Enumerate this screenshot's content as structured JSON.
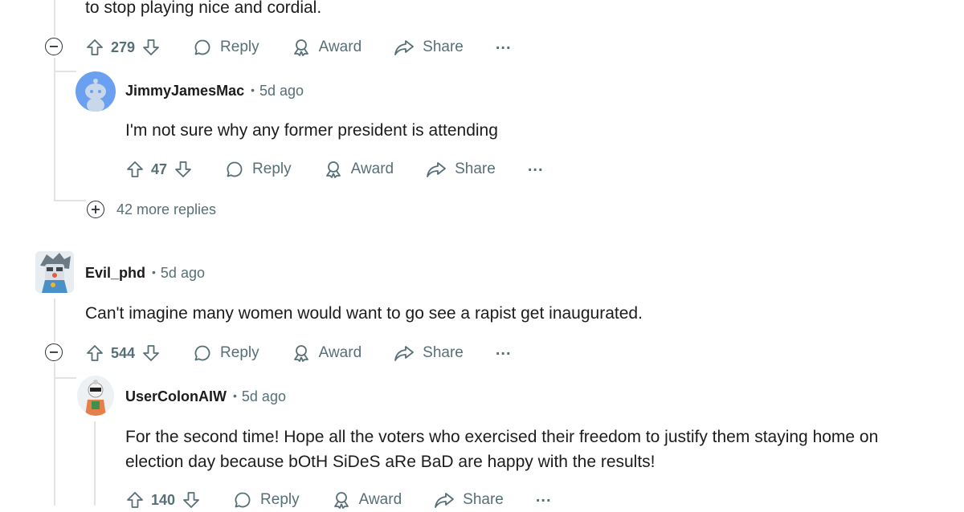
{
  "top_comment": {
    "text_tail": "to stop playing nice and cordial.",
    "score": "279"
  },
  "reply1": {
    "username": "JimmyJamesMac",
    "time": "5d ago",
    "text": "I'm not sure why any former president is attending",
    "score": "47"
  },
  "more_replies": "42 more replies",
  "comment2": {
    "username": "Evil_phd",
    "time": "5d ago",
    "text": "Can't imagine many women would want to go see a rapist get inaugurated.",
    "score": "544"
  },
  "reply2": {
    "username": "UserColonAIW",
    "time": "5d ago",
    "text_line1": "For the second time! Hope all the voters who exercised their freedom to justify them staying home on",
    "text_line2": "election day because bOtH SiDeS aRe BaD are happy with the results!",
    "score": "140"
  },
  "actions": {
    "reply": "Reply",
    "award": "Award",
    "share": "Share",
    "overflow": "..."
  },
  "colors": {
    "text": "#1c1c1c",
    "meta": "#576f76",
    "thread_line": "#e0e4e6",
    "avatar_blue": "#6b9ff0"
  }
}
